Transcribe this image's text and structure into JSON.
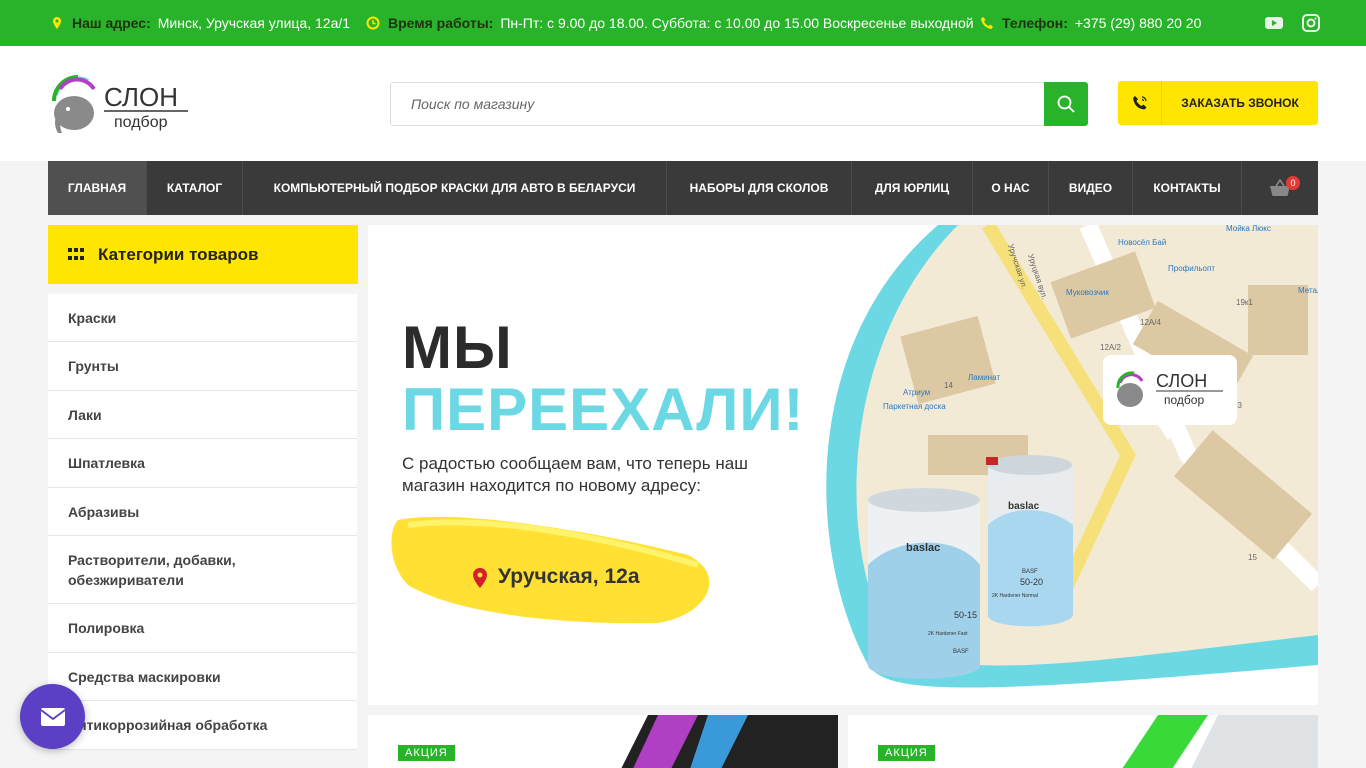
{
  "topbar": {
    "address_label": "Наш адрес:",
    "address_value": "Минск, Уручская улица, 12а/1",
    "hours_label": "Время работы:",
    "hours_value": "Пн-Пт: с 9.00 до 18.00. Суббота: с 10.00 до 15.00 Воскресенье выходной",
    "phone_label": "Телефон:",
    "phone_value": "+375 (29) 880 20 20",
    "socials": [
      "youtube-icon",
      "instagram-icon"
    ]
  },
  "header": {
    "logo_top": "СЛОН",
    "logo_bottom": "подбор",
    "search_placeholder": "Поиск по магазину",
    "callback_label": "ЗАКАЗАТЬ ЗВОНОК"
  },
  "nav": {
    "items": [
      {
        "label": "ГЛАВНАЯ",
        "active": true
      },
      {
        "label": "КАТАЛОГ"
      },
      {
        "label": "КОМПЬЮТЕРНЫЙ ПОДБОР КРАСКИ ДЛЯ АВТО В БЕЛАРУСИ"
      },
      {
        "label": "НАБОРЫ ДЛЯ СКОЛОВ"
      },
      {
        "label": "ДЛЯ ЮРЛИЦ"
      },
      {
        "label": "О НАС"
      },
      {
        "label": "ВИДЕО"
      },
      {
        "label": "КОНТАКТЫ"
      }
    ],
    "cart_count": "0"
  },
  "categories": {
    "title": "Категории товаров",
    "items": [
      "Краски",
      "Грунты",
      "Лаки",
      "Шпатлевка",
      "Абразивы",
      "Растворители, добавки, обезжириватели",
      "Полировка",
      "Средства маскировки",
      "Антикоррозийная обработка"
    ]
  },
  "banner": {
    "title_line1": "МЫ",
    "title_line2": "ПЕРЕЕХАЛИ!",
    "subtitle": "С радостью сообщаем вам, что теперь наш магазин находится по новому адресу:",
    "address": "Уручская, 12а",
    "map_labels": [
      "Уручская ул.",
      "Уруцкая вул.",
      "Новосёл Бай",
      "Профильопт",
      "Муковозчик",
      "Атриум",
      "Ламинат",
      "Паркетная доска",
      "12А/4",
      "12А/2",
      "19к1",
      "14",
      "13",
      "15",
      "Метал",
      "Мойка Люкс"
    ],
    "logo_top": "СЛОН",
    "logo_bottom": "подбор",
    "product1": {
      "brand": "baslac",
      "code": "50-15",
      "name": "2K Hardener Fast",
      "maker": "BASF"
    },
    "product2": {
      "brand": "baslac",
      "code": "50-20",
      "name": "2K Hardener Normal",
      "maker": "BASF"
    }
  },
  "promos": [
    {
      "tag": "АКЦИЯ"
    },
    {
      "tag": "АКЦИЯ"
    }
  ],
  "colors": {
    "green": "#29b32a",
    "yellow": "#ffe500",
    "nav_dark": "#3a3a3a",
    "accent_cyan": "#6bd8e4",
    "fab_purple": "#5b3fc4"
  }
}
